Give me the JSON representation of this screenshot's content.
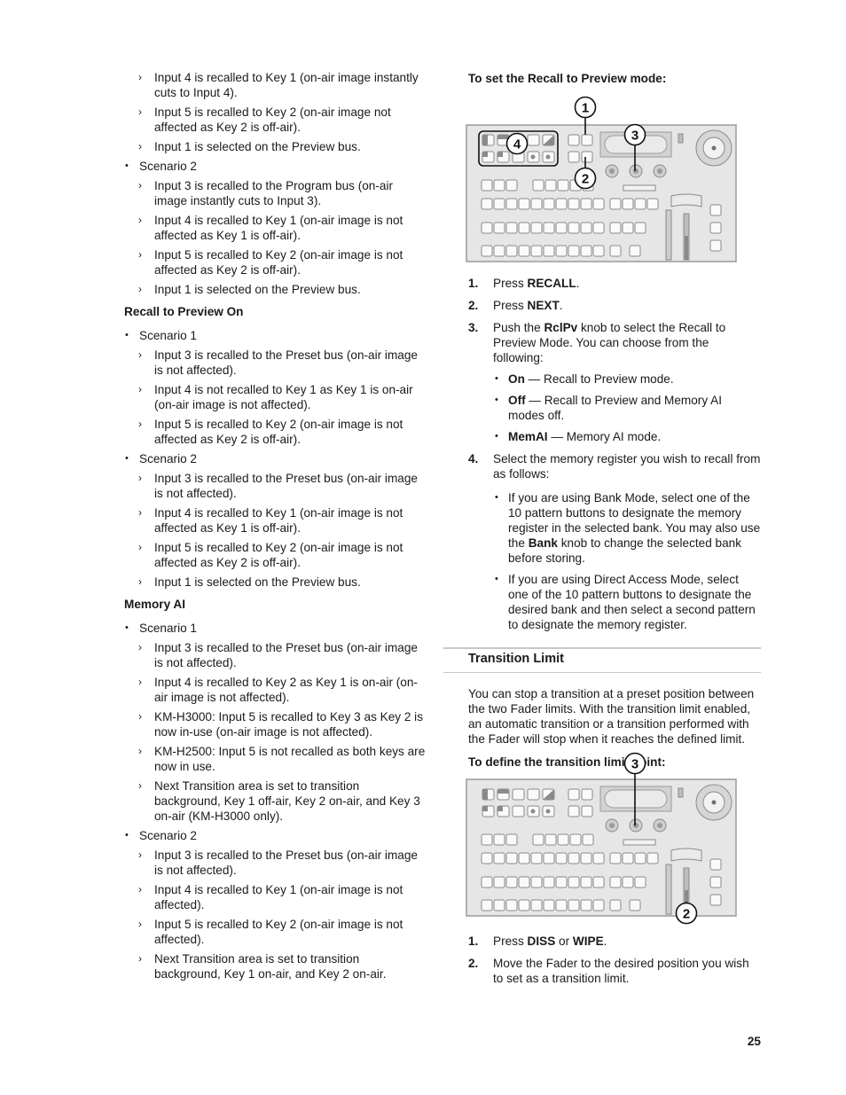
{
  "left_column": {
    "continuation_items": [
      "Input 4 is recalled to Key 1 (on-air image instantly cuts to Input 4).",
      "Input 5 is recalled to Key 2 (on-air image not affected as Key 2 is off-air).",
      "Input 1 is selected on the Preview bus."
    ],
    "continuation_scenario": {
      "label": "Scenario 2",
      "items": [
        "Input 3 is recalled to the Program bus (on-air image instantly cuts to Input 3).",
        "Input 4 is recalled to Key 1 (on-air image is not affected as Key 1 is off-air).",
        "Input 5 is recalled to Key 2 (on-air image is not affected as Key 2 is off-air).",
        "Input 1 is selected on the Preview bus."
      ]
    },
    "recall_to_preview_on": {
      "heading": "Recall to Preview On",
      "scenarios": [
        {
          "label": "Scenario 1",
          "items": [
            "Input 3 is recalled to the Preset bus (on-air image is not affected).",
            "Input 4 is not recalled to Key 1 as Key 1 is on-air (on-air image is not affected).",
            "Input 5 is recalled to Key 2 (on-air image is not affected as Key 2 is off-air)."
          ]
        },
        {
          "label": "Scenario 2",
          "items": [
            "Input 3 is recalled to the Preset bus (on-air image is not affected).",
            "Input 4 is recalled to Key 1 (on-air image is not affected as Key 1 is off-air).",
            "Input 5 is recalled to Key 2 (on-air image is not affected as Key 2 is off-air).",
            "Input 1 is selected on the Preview bus."
          ]
        }
      ]
    },
    "memory_ai": {
      "heading": "Memory AI",
      "scenarios": [
        {
          "label": "Scenario 1",
          "items": [
            "Input 3 is recalled to the Preset bus (on-air image is not affected).",
            "Input 4 is recalled to Key 2 as Key 1 is on-air (on-air image is not affected).",
            "KM-H3000: Input 5 is recalled to Key 3 as Key 2 is now in-use (on-air image is not affected).",
            "KM-H2500: Input 5 is not recalled as both keys are now in use.",
            "Next Transition area is set to transition background, Key 1 off-air, Key 2 on-air, and Key 3 on-air (KM-H3000 only)."
          ]
        },
        {
          "label": "Scenario 2",
          "items": [
            "Input 3 is recalled to the Preset bus (on-air image is not affected).",
            "Input 4 is recalled to Key 1 (on-air image is not affected).",
            "Input 5 is recalled to Key 2 (on-air image is not affected).",
            "Next Transition area is set to transition background, Key 1 on-air, and Key 2 on-air."
          ]
        }
      ]
    }
  },
  "right_column": {
    "recall_procedure": {
      "heading": "To set the Recall to Preview mode:",
      "figure_callouts": [
        "1",
        "2",
        "3",
        "4"
      ],
      "steps": [
        {
          "num": "1.",
          "pre": "Press ",
          "bold": "RECALL",
          "post": "."
        },
        {
          "num": "2.",
          "pre": "Press ",
          "bold": "NEXT",
          "post": "."
        },
        {
          "num": "3.",
          "pre": "Push the ",
          "bold": "RclPv",
          "post": " knob to select the Recall to Preview Mode. You can choose from the following:",
          "options": [
            {
              "bold": "On",
              "text": " — Recall to Preview mode."
            },
            {
              "bold": "Off",
              "text": " — Recall to Preview and Memory AI modes off."
            },
            {
              "bold": "MemAI",
              "text": " — Memory AI mode."
            }
          ]
        },
        {
          "num": "4.",
          "pre": "Select the memory register you wish to recall from as follows:",
          "bold": "",
          "post": "",
          "options": [
            {
              "pre": "If you are using Bank Mode, select one of the 10 pattern buttons to designate the memory register in the selected bank. You may also use the ",
              "bold": "Bank",
              "post": " knob to change the selected bank before storing."
            },
            {
              "pre": "If you are using Direct Access Mode, select one of the 10 pattern buttons to designate the desired bank and then select a second pattern to designate the memory register.",
              "bold": "",
              "post": ""
            }
          ]
        }
      ]
    },
    "transition_limit": {
      "title": "Transition Limit",
      "intro": "You can stop a transition at a preset position between the two Fader limits. With the transition limit enabled, an automatic transition or a transition performed with the Fader will stop when it reaches the defined limit.",
      "heading": "To define the transition limit point:",
      "figure_callouts": [
        "3",
        "2"
      ],
      "steps": [
        {
          "num": "1.",
          "pre": "Press ",
          "bold": "DISS",
          "mid": " or ",
          "bold2": "WIPE",
          "post": "."
        },
        {
          "num": "2.",
          "pre": "Move the Fader to the desired position you wish to set as a transition limit."
        }
      ]
    }
  },
  "page_number": "25"
}
